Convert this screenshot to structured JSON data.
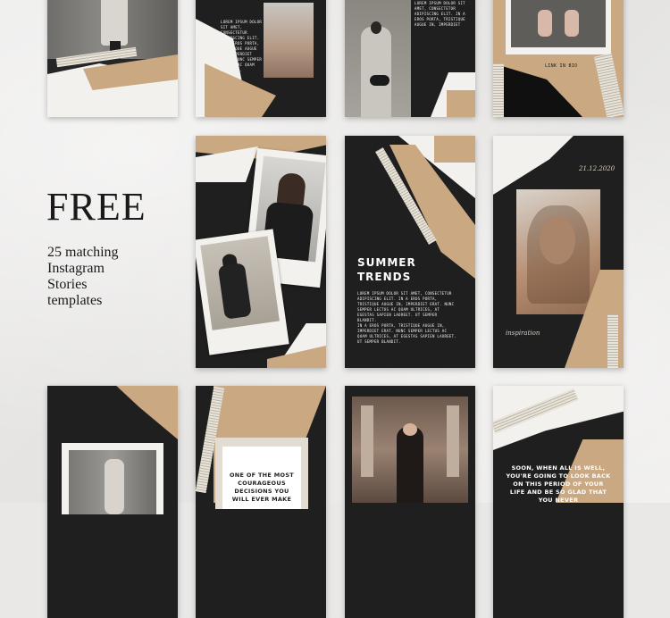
{
  "left_panel": {
    "title": "FREE",
    "subtitle_lines": [
      "25 matching",
      "Instagram",
      "Stories",
      "templates"
    ]
  },
  "cards": {
    "c2_body": "LOREM IPSUM DOLOR SIT AMET, CONSECTETUR ADIPISCING ELIT. IN A EROS PORTA, TRISTIQUE AUGUE IN, IMPERDIET ERAT. NUNC SEMPER LECTUS AC QUAM ULTRICES.",
    "c3_body": "LOREM IPSUM DOLOR SIT AMET, CONSECTETUR ADIPISCING ELIT. IN A EROS PORTA, TRISTIQUE AUGUE IN, IMPERDIET",
    "c4_caption": "LINK IN BIO",
    "summer_title_1": "SUMMER",
    "summer_title_2": "TRENDS",
    "summer_body_1": "LOREM IPSUM DOLOR SIT AMET, CONSECTETUR ADIPISCING ELIT. IN A EROS PORTA, TRISTIQUE AUGUE IN, IMPERDIET ERAT. NUNC SEMPER LECTUS AC QUAM ULTRICES, AT EGESTAS SAPIEN LAOREET. UT SEMPER BLANDIT.",
    "summer_body_2": "IN A EROS PORTA, TRISTIQUE AUGUE IN, IMPERDIET ERAT. NUNC SEMPER LECTUS AC QUAM ULTRICES, AT EGESTAS SAPIEN LAOREET. UT SEMPER BLANDIT.",
    "date": "21.12.2020",
    "inspiration": "inspiration",
    "quote_1": "ONE OF THE MOST COURAGEOUS DECISIONS YOU WILL EVER MAKE",
    "quote_2": "SOON, WHEN ALL IS WELL, YOU'RE GOING TO LOOK BACK ON THIS PERIOD OF YOUR LIFE AND BE SO GLAD THAT YOU NEVER"
  },
  "colors": {
    "tan": "#c9a882",
    "dark": "#1f1f1f",
    "paper_white": "#f3f1ed",
    "background": "#e9e8e6"
  }
}
